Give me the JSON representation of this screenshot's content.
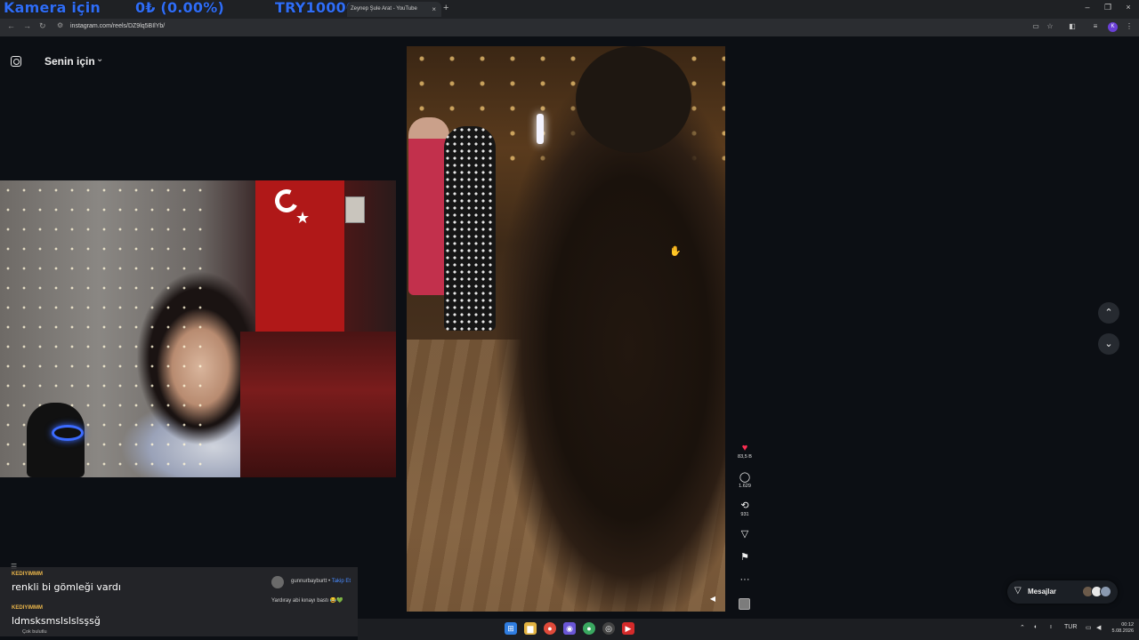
{
  "stream_overlay": {
    "camera_label": "Kamera için",
    "balance": "0₺ (0.00%)",
    "goal": "TRY10000"
  },
  "browser": {
    "tab_title": "Zeynep Şule Arat - YouTube",
    "tab_close": "×",
    "new_tab": "+",
    "url": "instagram.com/reels/DZ9lq5BIlYb/",
    "profile_initial": "K",
    "window_controls": [
      "–",
      "❐",
      "×"
    ]
  },
  "instagram": {
    "feed_title": "Senin için",
    "feed_chevron": "⌄",
    "actions": {
      "likes": "83,5 B",
      "comments": "1.629",
      "reposts": "931"
    },
    "messages_label": "Mesajlar",
    "comment_preview": {
      "user": "gunnurbayburtt",
      "separator": " • ",
      "follow": "Takip Et",
      "text": "Yardıray abi kınayı bastı 😂💚"
    }
  },
  "chat": {
    "messages": [
      {
        "user": "KEDIYIMMM",
        "text": "renkli bi gömleği vardı"
      },
      {
        "user": "KEDIYIMMM",
        "text": "ldmsksmslslslsşsğ"
      }
    ],
    "footer": "Çok bulutlu"
  },
  "taskbar": {
    "lang": "TUR",
    "time": "00:12",
    "date": "5.08.2026"
  },
  "icons": {
    "heart": "heart-icon",
    "comment": "comment-icon",
    "repost": "repost-icon",
    "share": "share-icon",
    "save": "bookmark-icon",
    "more": "more-icon"
  },
  "colors": {
    "overlay_blue": "#2f6df6",
    "like_red": "#ff2e52",
    "chat_username": "#e8b44a",
    "follow_blue": "#4a8cff"
  }
}
